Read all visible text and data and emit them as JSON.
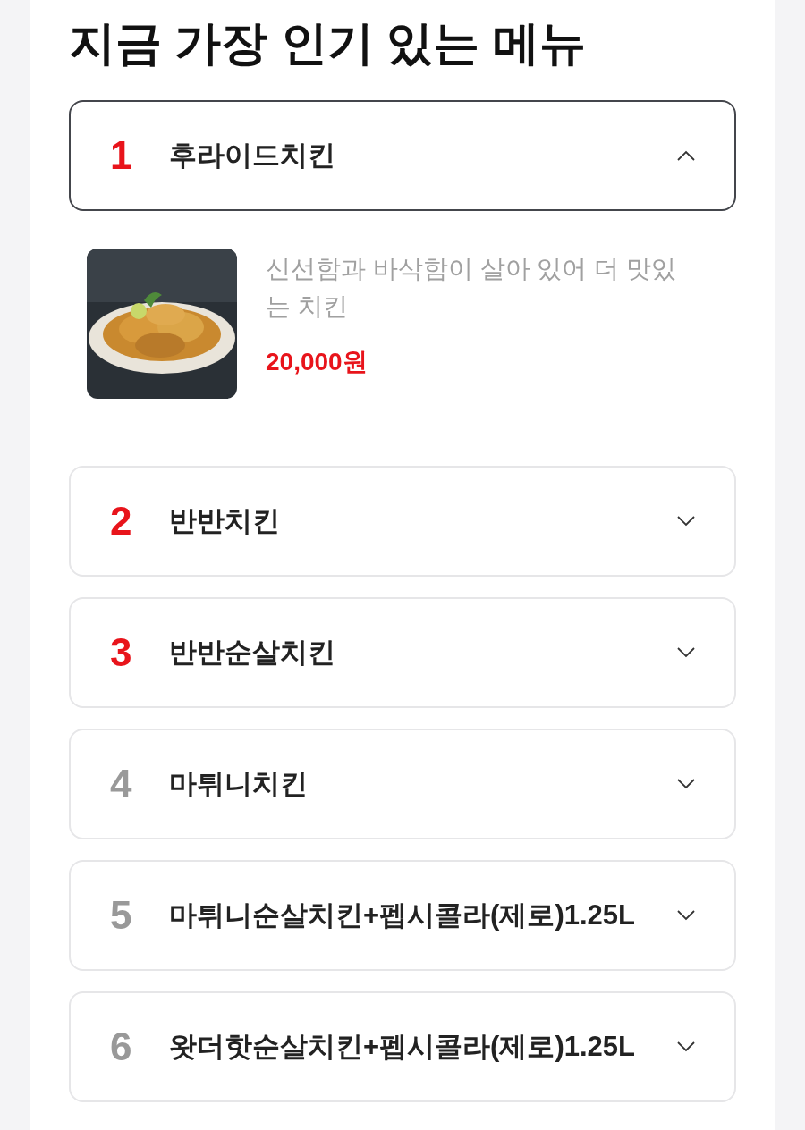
{
  "title": "지금 가장 인기 있는 메뉴",
  "items": [
    {
      "rank": "1",
      "color": "#e8141b",
      "name": "후라이드치킨",
      "expanded": true,
      "description": "신선함과 바삭함이 살아 있어 더 맛있는 치킨",
      "price": "20,000원"
    },
    {
      "rank": "2",
      "color": "#e8141b",
      "name": "반반치킨",
      "expanded": false
    },
    {
      "rank": "3",
      "color": "#e8141b",
      "name": "반반순살치킨",
      "expanded": false
    },
    {
      "rank": "4",
      "color": "#999999",
      "name": "마튀니치킨",
      "expanded": false
    },
    {
      "rank": "5",
      "color": "#999999",
      "name": "마튀니순살치킨+펩시콜라(제로)1.25L",
      "expanded": false
    },
    {
      "rank": "6",
      "color": "#999999",
      "name": "왓더핫순살치킨+펩시콜라(제로)1.25L",
      "expanded": false
    }
  ]
}
